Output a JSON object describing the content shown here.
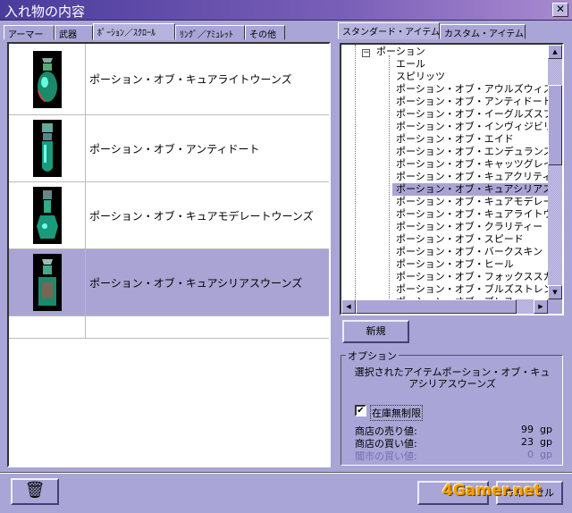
{
  "window": {
    "title": "入れ物の内容",
    "close": "✕"
  },
  "left_tabs": [
    "アーマー",
    "武器",
    "ﾎﾟｰｼｮﾝ／ｽｸﾛｰﾙ",
    "ﾘﾝｸﾞ／ｱﾐｭﾚｯﾄ",
    "その他"
  ],
  "items": [
    {
      "name": "ポーション・オブ・キュアライトウーンズ",
      "icon": "potion-round-green"
    },
    {
      "name": "ポーション・オブ・アンティドート",
      "icon": "potion-vial-green"
    },
    {
      "name": "ポーション・オブ・キュアモデレートウーンズ",
      "icon": "potion-flask-green"
    },
    {
      "name": "ポーション・オブ・キュアシリアスウーンズ",
      "icon": "potion-square-green",
      "selected": true
    }
  ],
  "right_tabs": [
    "スタンダード・アイテム",
    "カスタム・アイテム"
  ],
  "tree": {
    "root": "ポーション",
    "children": [
      "エール",
      "スピリッツ",
      "ポーション・オブ・アウルズウィズダム",
      "ポーション・オブ・アンティドート",
      "ポーション・オブ・イーグルズスプレンダー",
      "ポーション・オブ・インヴィジビリティ",
      "ポーション・オブ・エイド",
      "ポーション・オブ・エンデュランス",
      "ポーション・オブ・キャッツグレイス",
      "ポーション・オブ・キュアクリティカルウーンズ",
      "ポーション・オブ・キュアシリアスウーンズ",
      "ポーション・オブ・キュアモデレートウーンズ",
      "ポーション・オブ・キュアライトウーンズ",
      "ポーション・オブ・クラリティー",
      "ポーション・オブ・スピード",
      "ポーション・オブ・バークスキン",
      "ポーション・オブ・ヒール",
      "ポーション・オブ・フォックススカニング",
      "ポーション・オブ・ブルズストレングス",
      "ポーション・オブ・ブレス"
    ],
    "selected_index": 10
  },
  "new_button": "新規",
  "options": {
    "legend": "オプション",
    "selected_text": "選択されたアイテムポーション・オブ・キュアシリアスウーンズ",
    "unlimited_label": "在庫無制限",
    "unlimited_checked": true,
    "sell_label": "商店の売り値:",
    "sell_value": "99",
    "sell_unit": "gp",
    "buy_label": "商店の買い値:",
    "buy_value": "23",
    "buy_unit": "gp",
    "black_label": "闇市の買い値:",
    "black_value": "0",
    "black_unit": "gp"
  },
  "bottom": {
    "ok": "",
    "cancel": "キャンセル",
    "watermark": "4Gamer.net"
  }
}
